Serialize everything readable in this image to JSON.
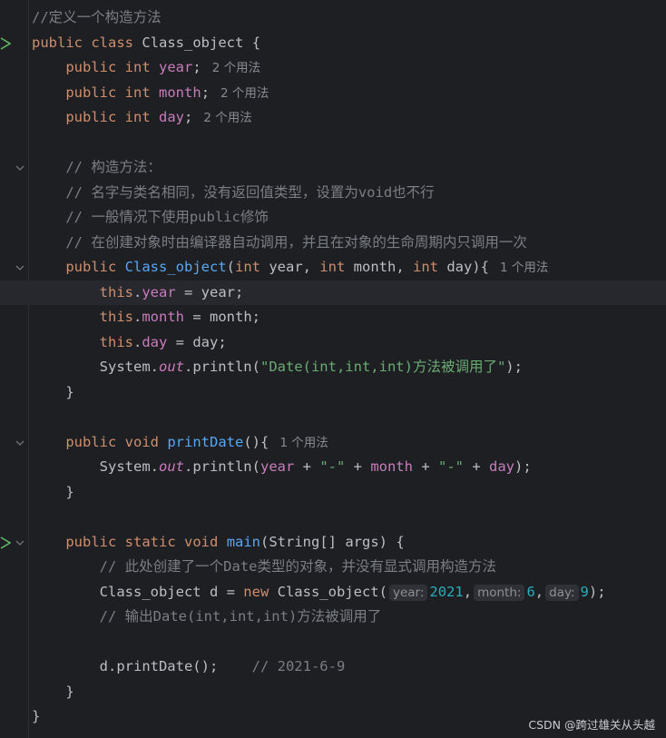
{
  "lines": [
    {
      "kind": "comment",
      "text": "//定义一个构造方法"
    },
    {
      "kind": "class_decl",
      "kw1": "public",
      "kw2": "class",
      "name": "Class_object",
      "brace": "{"
    },
    {
      "kind": "field",
      "kw1": "public",
      "kw2": "int",
      "name": "year",
      "semi": ";",
      "hint": "2 个用法"
    },
    {
      "kind": "field",
      "kw1": "public",
      "kw2": "int",
      "name": "month",
      "semi": ";",
      "hint": "2 个用法"
    },
    {
      "kind": "field",
      "kw1": "public",
      "kw2": "int",
      "name": "day",
      "semi": ";",
      "hint": "2 个用法"
    },
    {
      "kind": "blank"
    },
    {
      "kind": "comment",
      "text": "// 构造方法："
    },
    {
      "kind": "comment",
      "text": "// 名字与类名相同，没有返回值类型，设置为void也不行"
    },
    {
      "kind": "comment",
      "text": "// 一般情况下使用public修饰"
    },
    {
      "kind": "comment",
      "text": "// 在创建对象时由编译器自动调用，并且在对象的生命周期内只调用一次"
    },
    {
      "kind": "ctor_decl",
      "kw1": "public",
      "name": "Class_object",
      "open": "(",
      "t1": "int",
      "p1": " year, ",
      "t2": "int",
      "p2": " month, ",
      "t3": "int",
      "p3": " day){",
      "hint": "1 个用法"
    },
    {
      "kind": "assign",
      "this": "this",
      "dot": ".",
      "field": "year",
      "rest": " = year;"
    },
    {
      "kind": "assign",
      "this": "this",
      "dot": ".",
      "field": "month",
      "rest": " = month;"
    },
    {
      "kind": "assign",
      "this": "this",
      "dot": ".",
      "field": "day",
      "rest": " = day;"
    },
    {
      "kind": "println1",
      "sys": "System.",
      "out": "out",
      "mid": ".println(",
      "str": "\"Date(int,int,int)方法被调用了\"",
      "end": ");"
    },
    {
      "kind": "brace",
      "text": "}"
    },
    {
      "kind": "blank"
    },
    {
      "kind": "method_decl",
      "kw1": "public",
      "kw2": "void",
      "name": "printDate",
      "rest": "(){",
      "hint": "1 个用法"
    },
    {
      "kind": "println2",
      "sys": "System.",
      "out": "out",
      "mid": ".println(",
      "f1": "year",
      "op1": " + ",
      "s1": "\"-\"",
      "op2": " + ",
      "f2": "month",
      "op3": " + ",
      "s2": "\"-\"",
      "op4": " + ",
      "f3": "day",
      "end": ");"
    },
    {
      "kind": "brace",
      "text": "}"
    },
    {
      "kind": "blank"
    },
    {
      "kind": "main_decl",
      "kw1": "public",
      "kw2": "static",
      "kw3": "void",
      "name": "main",
      "rest": "(String[] args) {"
    },
    {
      "kind": "comment",
      "text": "// 此处创建了一个Date类型的对象，并没有显式调用构造方法"
    },
    {
      "kind": "new_stmt",
      "pre": "Class_object d = ",
      "kw": "new",
      "cls": " Class_object(",
      "h1": "year:",
      "v1": "2021",
      "c1": ",",
      "h2": "month:",
      "v2": "6",
      "c2": ",",
      "h3": "day:",
      "v3": "9",
      "end": ");"
    },
    {
      "kind": "comment",
      "text": "// 输出Date(int,int,int)方法被调用了"
    },
    {
      "kind": "blank"
    },
    {
      "kind": "call_stmt",
      "code": "d.printDate();",
      "gap": "    ",
      "comment": "// 2021-6-9"
    },
    {
      "kind": "brace",
      "text": "}"
    },
    {
      "kind": "brace",
      "text": "}"
    }
  ],
  "watermark": "CSDN @跨过雄关从头越"
}
